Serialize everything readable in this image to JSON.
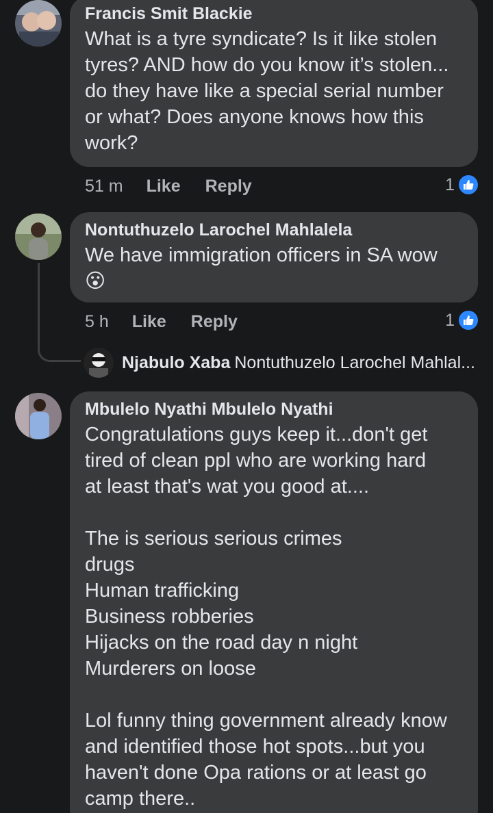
{
  "comments": [
    {
      "author": "Francis Smit Blackie",
      "text": "What is a tyre syndicate? Is it like stolen\ntyres? AND how do you know it’s stolen...\ndo they have like a special serial number\nor what? Does anyone knows how this\nwork?",
      "time": "51 m",
      "like_label": "Like",
      "reply_label": "Reply",
      "reactions": "1"
    },
    {
      "author": "Nontuthuzelo Larochel Mahlalela",
      "text": "We have immigration officers in SA wow",
      "emoji": "😮",
      "time": "5 h",
      "like_label": "Like",
      "reply_label": "Reply",
      "reactions": "1",
      "reply_preview": {
        "author": "Njabulo Xaba",
        "snippet": "Nontuthuzelo Larochel Mahlal..."
      }
    },
    {
      "author": "Mbulelo Nyathi Mbulelo Nyathi",
      "text": "Congratulations guys keep it...don't get\ntired of clean ppl who are working hard\nat least that's wat you good at....\n\nThe is serious serious crimes\ndrugs\nHuman trafficking\nBusiness robberies\nHijacks on the road day n night\nMurderers on loose\n\nLol funny thing government already know\nand identified those hot spots...but you\nhaven't done Opa rations or at least go\ncamp there.."
    }
  ],
  "colors": {
    "background": "#18191a",
    "bubble": "#3a3b3c",
    "like_blue": "#2d88ff",
    "secondary_text": "#b0b3b8"
  },
  "icons": {
    "like_badge": "thumbs-up-icon"
  }
}
